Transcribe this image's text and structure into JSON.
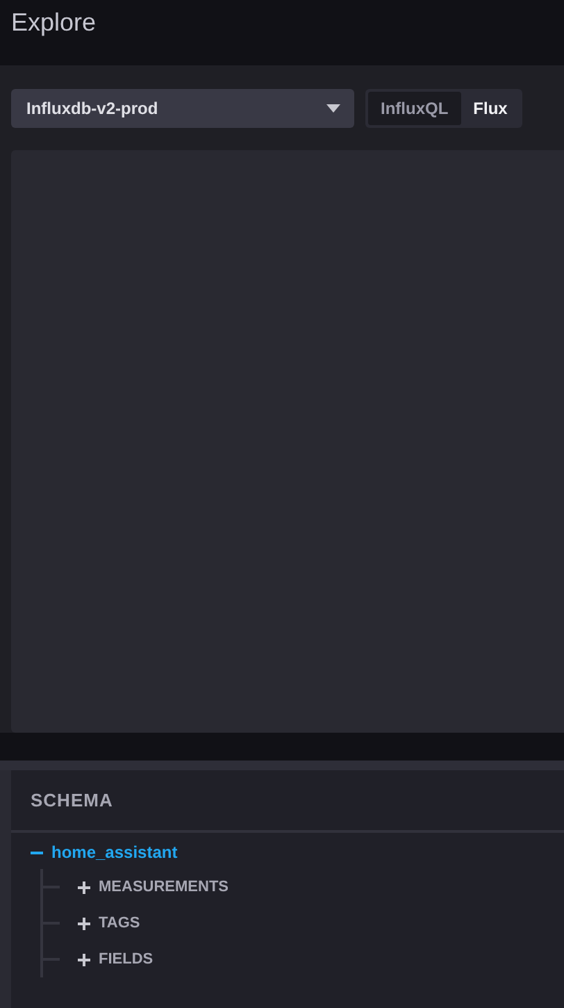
{
  "page_title": "Explore",
  "source_select": {
    "value": "Influxdb-v2-prod"
  },
  "query_language_tabs": [
    {
      "label": "InfluxQL",
      "selected": false
    },
    {
      "label": "Flux",
      "selected": true
    }
  ],
  "schema": {
    "title": "SCHEMA",
    "tree": [
      {
        "label": "home_assistant",
        "expanded": true,
        "children": [
          {
            "label": "MEASUREMENTS",
            "expanded": false
          },
          {
            "label": "TAGS",
            "expanded": false
          },
          {
            "label": "FIELDS",
            "expanded": false
          }
        ]
      }
    ]
  }
}
